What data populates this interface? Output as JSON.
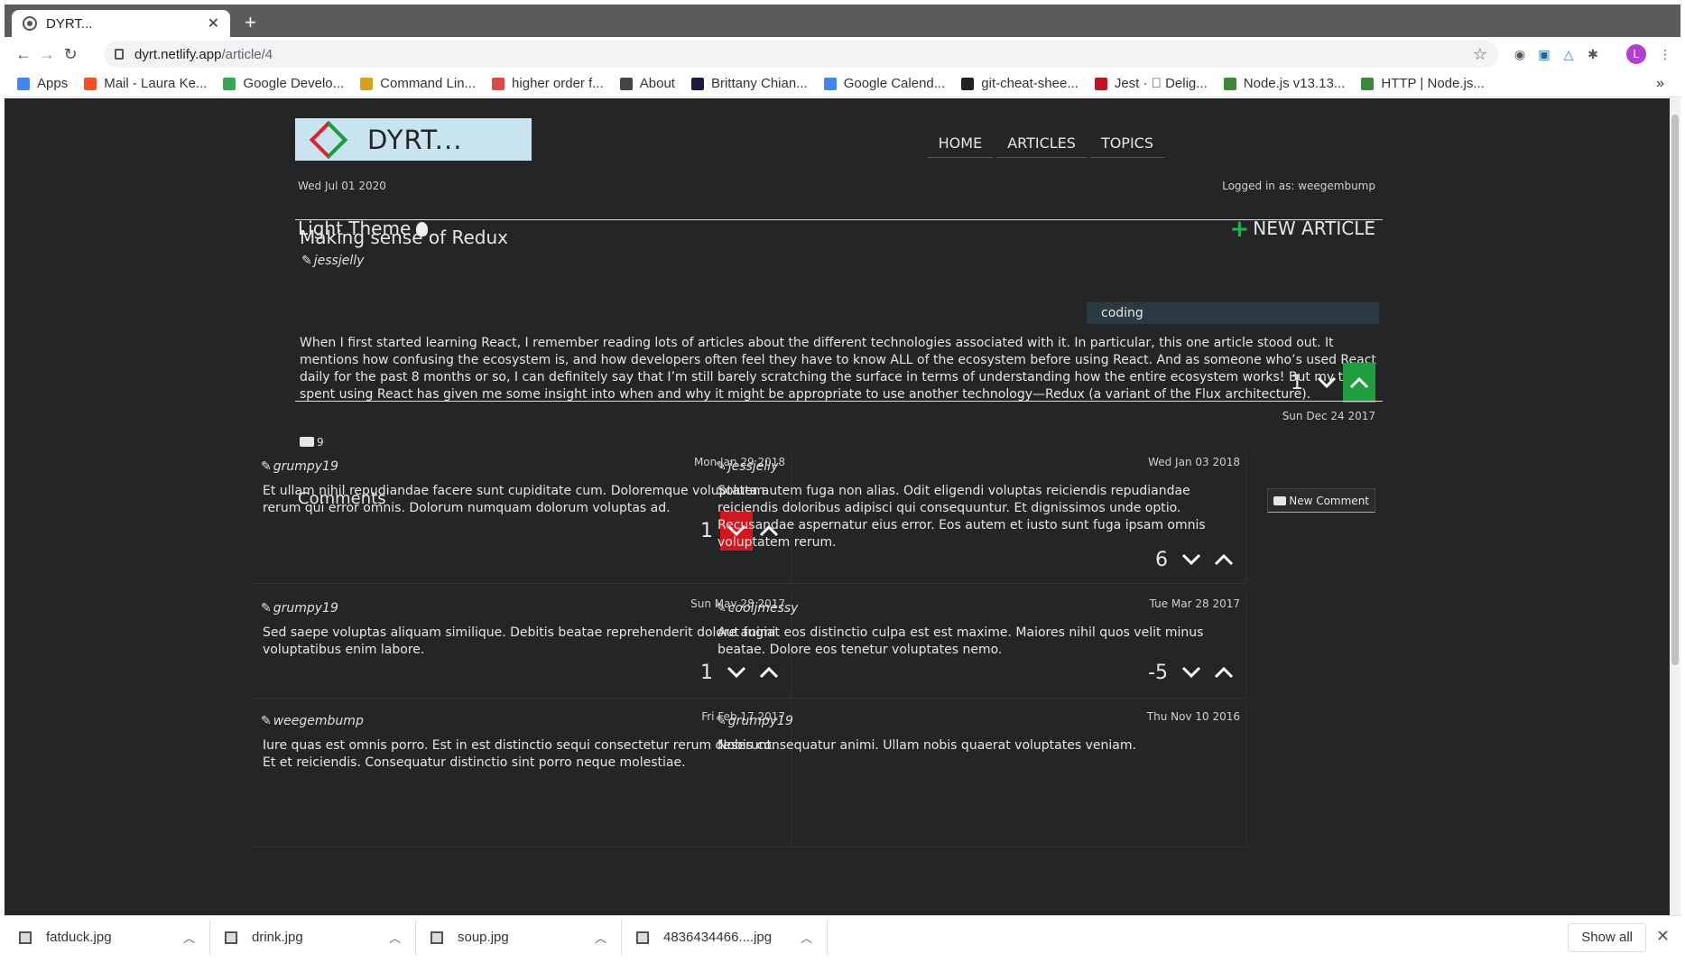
{
  "browser": {
    "tab_title": "DYRT...",
    "tab_close": "✕",
    "new_tab": "+",
    "url_host": "dyrt.netlify.app",
    "url_path": "/article/4",
    "profile_initial": "L",
    "bookmarks": [
      {
        "label": "Apps",
        "color": "#4285f4"
      },
      {
        "label": "Mail - Laura Ke...",
        "color": "#f25022"
      },
      {
        "label": "Google Develo...",
        "color": "#34a853"
      },
      {
        "label": "Command Lin...",
        "color": "#d4a017"
      },
      {
        "label": "higher order f...",
        "color": "#e04848"
      },
      {
        "label": "About",
        "color": "#444444"
      },
      {
        "label": "Brittany Chian...",
        "color": "#1a1a40"
      },
      {
        "label": "Google Calend...",
        "color": "#4285f4"
      },
      {
        "label": "git-cheat-shee...",
        "color": "#222222"
      },
      {
        "label": "Jest · ⃞ Delig...",
        "color": "#c21325"
      },
      {
        "label": "Node.js v13.13...",
        "color": "#3c873a"
      },
      {
        "label": "HTTP | Node.js...",
        "color": "#3c873a"
      }
    ],
    "bookmarks_more": "»"
  },
  "site": {
    "logo_text": "DYRT...",
    "nav": [
      "HOME",
      "ARTICLES",
      "TOPICS"
    ],
    "date": "Wed Jul 01 2020",
    "logged_in": "Logged in as: weegembump",
    "theme_toggle": "Light Theme",
    "new_article": "NEW ARTICLE"
  },
  "article": {
    "title": "Making sense of Redux",
    "author": "jessjelly",
    "topic": "coding",
    "body": "When I first started learning React, I remember reading lots of articles about the different technologies associated with it. In particular, this one article stood out. It mentions how confusing the ecosystem is, and how developers often feel they have to know ALL of the ecosystem before using React. And as someone who’s used React daily for the past 8 months or so, I can definitely say that I’m still barely scratching the surface in terms of understanding how the entire ecosystem works! But my time spent using React has given me some insight into when and why it might be appropriate to use another technology—Redux (a variant of the Flux architecture).",
    "date": "Sun Dec 24 2017",
    "comment_count": "9",
    "votes": "1",
    "vote_state": "up"
  },
  "comments_section": {
    "title": "Comments",
    "new_comment": "New Comment"
  },
  "comments": [
    {
      "author": "grumpy19",
      "date": "Mon Jan 29 2018",
      "body": "Et ullam nihil repudiandae facere sunt cupiditate cum. Doloremque voluptatem rerum qui error omnis. Dolorum numquam dolorum voluptas ad.",
      "votes": "1",
      "vote_state": "down"
    },
    {
      "author": "jessjelly",
      "date": "Wed Jan 03 2018",
      "body": "Soluta autem fuga non alias. Odit eligendi voluptas reiciendis repudiandae reiciendis doloribus adipisci qui consequuntur. Et dignissimos unde optio. Recusandae aspernatur eius error. Eos autem et iusto sunt fuga ipsam omnis voluptatem rerum.",
      "votes": "6",
      "vote_state": "none"
    },
    {
      "author": "grumpy19",
      "date": "Sun May 28 2017",
      "body": "Sed saepe voluptas aliquam similique. Debitis beatae reprehenderit dolore animi voluptatibus enim labore.",
      "votes": "1",
      "vote_state": "none"
    },
    {
      "author": "cooljmessy",
      "date": "Tue Mar 28 2017",
      "body": "Aut fugiat eos distinctio culpa est est maxime. Maiores nihil quos velit minus beatae. Dolore eos tenetur voluptates nemo.",
      "votes": "-5",
      "vote_state": "none"
    },
    {
      "author": "weegembump",
      "date": "Fri Feb 17 2017",
      "body": "Iure quas est omnis porro. Est in est distinctio sequi consectetur rerum deserunt. Et et reiciendis. Consequatur distinctio sint porro neque molestiae.",
      "votes": "",
      "vote_state": "none"
    },
    {
      "author": "grumpy19",
      "date": "Thu Nov 10 2016",
      "body": "Nobis consequatur animi. Ullam nobis quaerat voluptates veniam.",
      "votes": "",
      "vote_state": "none"
    }
  ],
  "downloads": [
    {
      "name": "fatduck.jpg"
    },
    {
      "name": "drink.jpg"
    },
    {
      "name": "soup.jpg"
    },
    {
      "name": "4836434466....jpg"
    }
  ],
  "downloads_show_all": "Show all",
  "downloads_close": "✕",
  "colors": {
    "page_bg": "#232526",
    "upvote_active": "#1f9e3e",
    "downvote_active": "#d2171f",
    "new_article_plus": "#1db34b",
    "topic_badge": "#2b3a42",
    "logo_bg": "#c8e4f1"
  }
}
